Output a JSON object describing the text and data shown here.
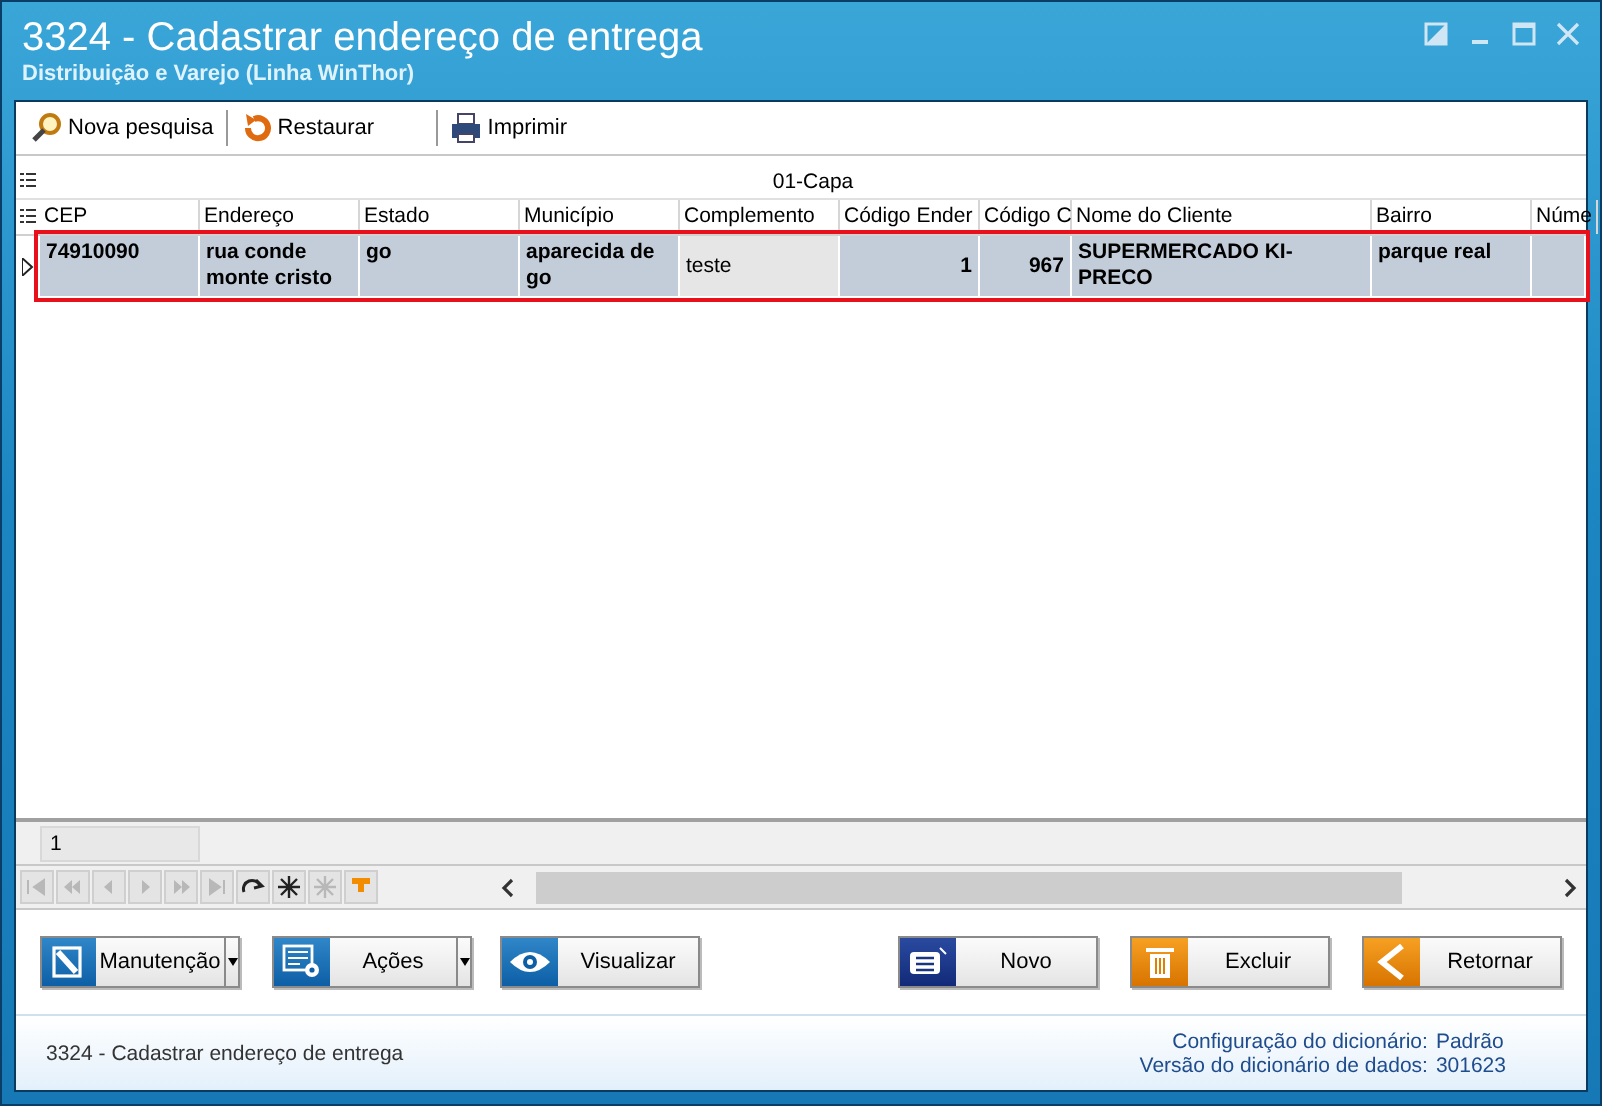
{
  "window": {
    "title": "3324 - Cadastrar endereço de entrega",
    "subtitle": "Distribuição e Varejo (Linha WinThor)"
  },
  "toolbar": [
    {
      "label": "Nova pesquisa"
    },
    {
      "label": "Restaurar"
    },
    {
      "label": "Imprimir"
    }
  ],
  "grid": {
    "band": "01-Capa",
    "columns": [
      {
        "label": "CEP",
        "kind": "text"
      },
      {
        "label": "Endereço",
        "kind": "text"
      },
      {
        "label": "Estado",
        "kind": "text"
      },
      {
        "label": "Município",
        "kind": "text"
      },
      {
        "label": "Complemento",
        "kind": "text"
      },
      {
        "label": "Código Ender",
        "kind": "number"
      },
      {
        "label": "Código C",
        "kind": "number"
      },
      {
        "label": "Nome do Cliente",
        "kind": "text"
      },
      {
        "label": "Bairro",
        "kind": "text"
      },
      {
        "label": "Núme",
        "kind": "text"
      }
    ],
    "rows": [
      {
        "selected": true,
        "highlighted": true,
        "cells": [
          {
            "text": "74910090",
            "focused": false
          },
          {
            "text": "rua conde monte cristo",
            "focused": false
          },
          {
            "text": "go",
            "focused": false
          },
          {
            "text": "aparecida de go",
            "focused": false
          },
          {
            "text": "teste",
            "focused": true
          },
          {
            "text": "1",
            "focused": false
          },
          {
            "text": "967",
            "focused": false
          },
          {
            "text": "SUPERMERCADO KI-PRECO",
            "focused": false
          },
          {
            "text": "parque real",
            "focused": false
          },
          {
            "text": "",
            "focused": false
          }
        ]
      }
    ],
    "footer": "1"
  },
  "buttons": [
    {
      "label": "Manutenção",
      "dropdown": true
    },
    {
      "label": "Ações",
      "dropdown": true
    },
    {
      "label": "Visualizar",
      "dropdown": false
    },
    {
      "label": "Novo",
      "dropdown": false
    },
    {
      "label": "Excluir",
      "dropdown": false
    },
    {
      "label": "Retornar",
      "dropdown": false
    }
  ],
  "status_bar": {
    "left": "3324 - Cadastrar endereço de entrega",
    "config_label": "Configuração do dicionário:",
    "config_value": "Padrão",
    "version_label": "Versão do dicionário de dados:",
    "version_value": "301623"
  }
}
